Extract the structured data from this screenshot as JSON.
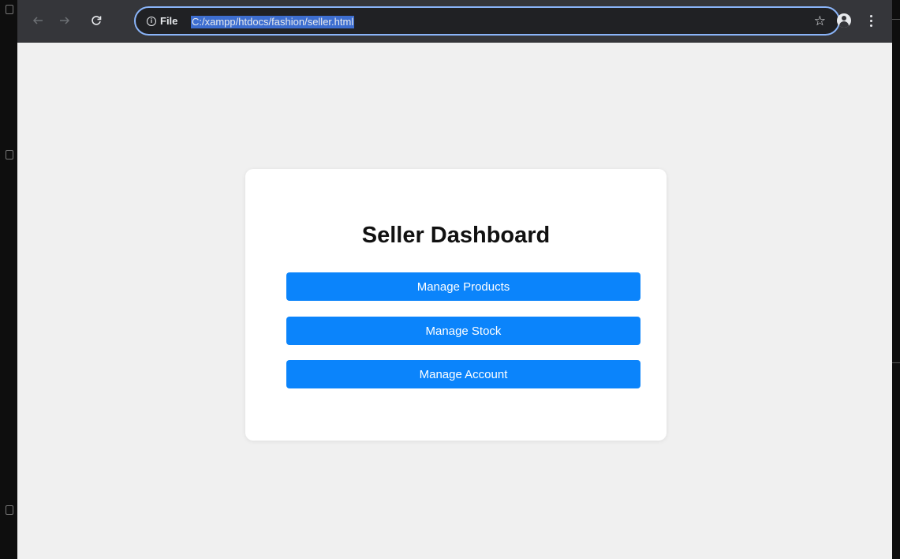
{
  "browser": {
    "site_info_label": "File",
    "url": "C:/xampp/htdocs/fashion/seller.html"
  },
  "icons": {
    "back": "arrow-left-icon",
    "forward": "arrow-right-icon",
    "reload": "reload-icon",
    "info": "info-icon",
    "bookmark": "star-icon",
    "profile": "profile-icon",
    "menu": "kebab-menu-icon"
  },
  "colors": {
    "page_background": "#f0f0f0",
    "card_background": "#ffffff",
    "button_background": "#0b84fb",
    "button_text": "#ffffff"
  },
  "dashboard": {
    "title": "Seller Dashboard",
    "buttons": [
      {
        "label": "Manage Products"
      },
      {
        "label": "Manage Stock"
      },
      {
        "label": "Manage Account"
      }
    ]
  }
}
